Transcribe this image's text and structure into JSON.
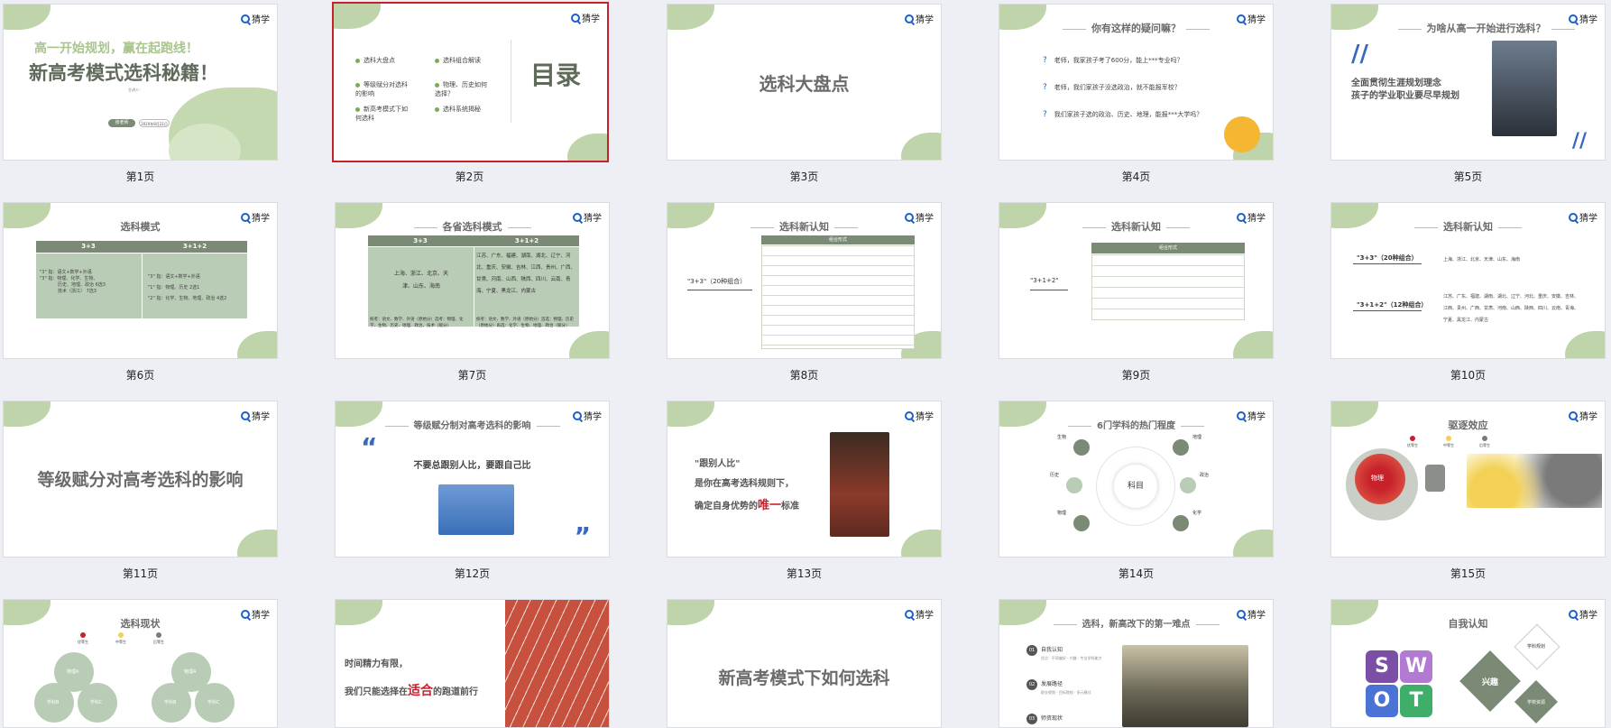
{
  "logo_text": "猜学",
  "slides": [
    {
      "caption": "第1页",
      "title_line1": "高一开始规划，赢在起跑线！",
      "title_line2": "新高考模式选科秘籍！",
      "subtitle": "主讲人：",
      "date_label": "2020年8月21日",
      "presenter": "张老师"
    },
    {
      "caption": "第2页",
      "menu_title": "目录",
      "items": [
        "选科大盘点",
        "选科组合解读",
        "等级赋分对选科的影响",
        "物理、历史如何选择？",
        "新高考模式下如何选科",
        "选科系统揭秘"
      ]
    },
    {
      "caption": "第3页",
      "title": "选科大盘点"
    },
    {
      "caption": "第4页",
      "title": "你有这样的疑问嘛？",
      "questions": [
        "老师，我家孩子考了600分，能上***专业吗？",
        "老师，我们家孩子没选政治，就不能报军校？",
        "我们家孩子选的政治、历史、地理，能报***大学吗？"
      ]
    },
    {
      "caption": "第5页",
      "title": "为啥从高一开始进行选科？",
      "quote_line1": "全面贯彻生涯规划理念",
      "quote_line2": "孩子的学业职业要尽早规划"
    },
    {
      "caption": "第6页",
      "title": "选科模式",
      "col1": "3+3",
      "col2": "3+1+2",
      "c1_lines": [
        "\"3\" 指：语文+数学+外语",
        "\"3\" 指：物理、化学、生物、",
        "历史、地理、政治 6选3",
        "技术（浙江） 7选3"
      ],
      "c2_lines": [
        "\"3\" 指：语文+数学+外语",
        "\"1\" 指：物理、历史 2选1",
        "\"2\" 指：化学、生物、地理、政治 4选2"
      ]
    },
    {
      "caption": "第7页",
      "title": "各省选科模式",
      "col1": "3+3",
      "col2": "3+1+2",
      "left_provinces": "上海、浙江、北京、天津、山东、海南",
      "right_provinces": "江苏、广东、福建、湖南、湖北、辽宁、河北、重庆、安徽、吉林、江西、贵州、广西、甘肃、河南、山西、陕西、四川、云南、青海、宁夏、黑龙江、内蒙古",
      "foot_left": "统考：语文、数学、外语（原始分）选考：物理、化学、生物、历史、地理、政治，技术（赋分）",
      "foot_right": "统考：语文、数学、外语（原始分）首选：物理、历史（原始分）再选：化学、生物、地理、政治（赋分）"
    },
    {
      "caption": "第8页",
      "title": "选科新认知",
      "label": "\"3+3\"（20种组合）",
      "table_head": "组合形式"
    },
    {
      "caption": "第9页",
      "title": "选科新认知",
      "label": "\"3+1+2\"",
      "table_head": "组合形式"
    },
    {
      "caption": "第10页",
      "title": "选科新认知",
      "label1": "\"3+3\"（20种组合）",
      "text1": "上海、浙江、北京、天津、山东、海南",
      "label2": "\"3+1+2\"（12种组合）",
      "text2": "江苏、广东、福建、湖南、湖北、辽宁、河北、重庆、安徽、吉林、江西、贵州、广西、甘肃、河南、山西、陕西、四川、云南、青海、宁夏、黑龙江、内蒙古"
    },
    {
      "caption": "第11页",
      "title": "等级赋分对高考选科的影响"
    },
    {
      "caption": "第12页",
      "title": "等级赋分制对高考选科的影响",
      "quote": "不要总跟别人比，要跟自己比"
    },
    {
      "caption": "第13页",
      "line1": "\"跟别人比\"",
      "line2": "是你在高考选科规则下，",
      "line3_a": "确定自身优势的",
      "line3_b": "唯一",
      "line3_c": "标准"
    },
    {
      "caption": "第14页",
      "title": "6门学科的热门程度",
      "center": "科目",
      "subjects": [
        "生物",
        "地理",
        "历史",
        "政治",
        "物理",
        "化学"
      ]
    },
    {
      "caption": "第15页",
      "title": "驱逐效应",
      "legend": [
        "优等生",
        "中等生",
        "后等生"
      ],
      "center_label": "物理"
    },
    {
      "caption": "",
      "title": "选科现状",
      "legend": [
        "优等生",
        "中等生",
        "后等生"
      ],
      "labels": [
        "物理A",
        "学科B",
        "学科C",
        "物理A",
        "学科B",
        "学科C"
      ]
    },
    {
      "caption": "",
      "line1": "时间精力有限，",
      "line2_a": "我们只能选择在",
      "line2_b": "适合",
      "line2_c": "的跑道前行"
    },
    {
      "caption": "",
      "title": "新高考模式下如何选科"
    },
    {
      "caption": "",
      "title": "选科，新高改下的第一难点",
      "items": [
        {
          "num": "01",
          "title": "自我认知",
          "desc": "优点 · 不同偏好 · 兴趣 · 专业学科能力"
        },
        {
          "num": "02",
          "title": "发展路径",
          "desc": "职业规划 · 目标院校 · 多元模式"
        },
        {
          "num": "03",
          "title": "师资现状",
          "desc": ""
        }
      ]
    },
    {
      "caption": "",
      "title": "自我认知",
      "swot": [
        "S",
        "W",
        "O",
        "T"
      ],
      "diamond_main": "兴趣",
      "diamond_a": "学科规划",
      "diamond_b": "学校资源"
    }
  ],
  "colors": {
    "green": "#a9c58e",
    "gray_text": "#6b6b6b",
    "red": "#c7222b",
    "blue": "#1a5fd0",
    "table_head": "#7a8a74"
  }
}
